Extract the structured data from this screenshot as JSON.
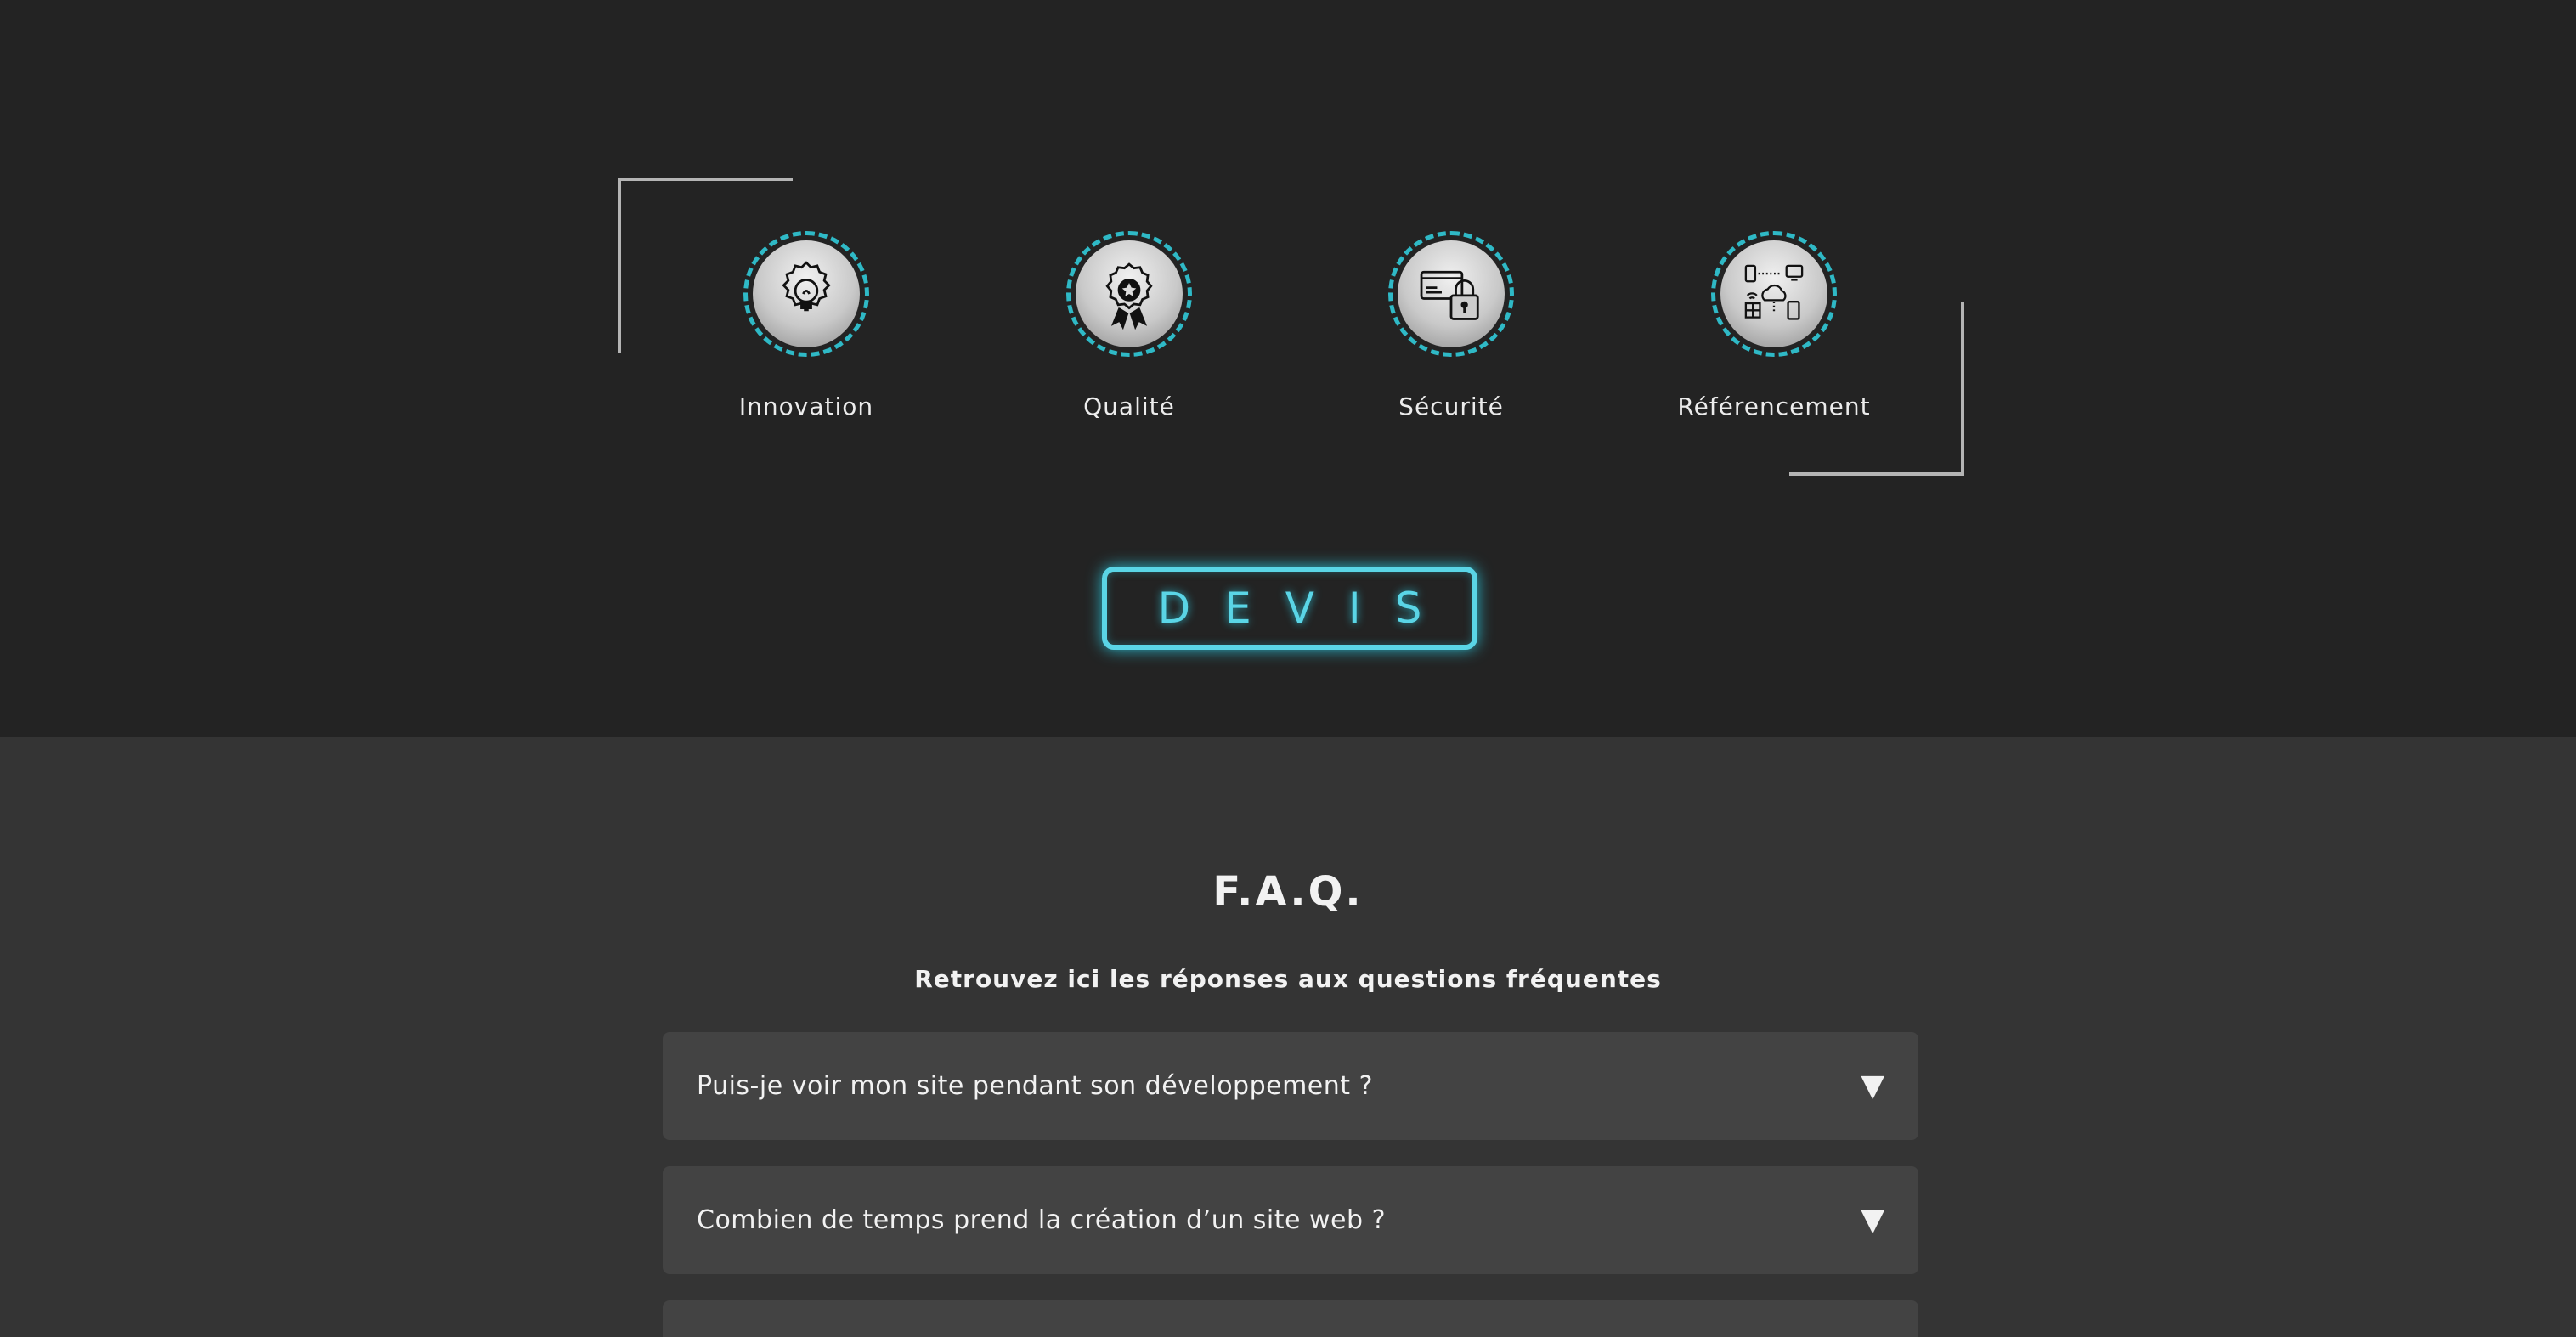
{
  "features": [
    {
      "label": "Innovation",
      "icon": "lightbulb-icon"
    },
    {
      "label": "Qualité",
      "icon": "award-ribbon-icon"
    },
    {
      "label": "Sécurité",
      "icon": "credit-card-lock-icon"
    },
    {
      "label": "Référencement",
      "icon": "network-cloud-devices-icon"
    }
  ],
  "devis": {
    "label": "DEVIS"
  },
  "faq": {
    "title": "F.A.Q.",
    "subtitle": "Retrouvez ici les réponses aux questions fréquentes",
    "items": [
      {
        "question": "Puis-je voir mon site pendant son développement ?",
        "arrow": "▼"
      },
      {
        "question": "Combien de temps prend la création d’un site web ?",
        "arrow": "▼"
      },
      {
        "question": "",
        "arrow": ""
      }
    ]
  },
  "colors": {
    "accent": "#5ad5e6",
    "badge_border": "#2fb9c6",
    "top_background": "#232323",
    "faq_background": "#343434",
    "faq_item_background": "#434343"
  }
}
